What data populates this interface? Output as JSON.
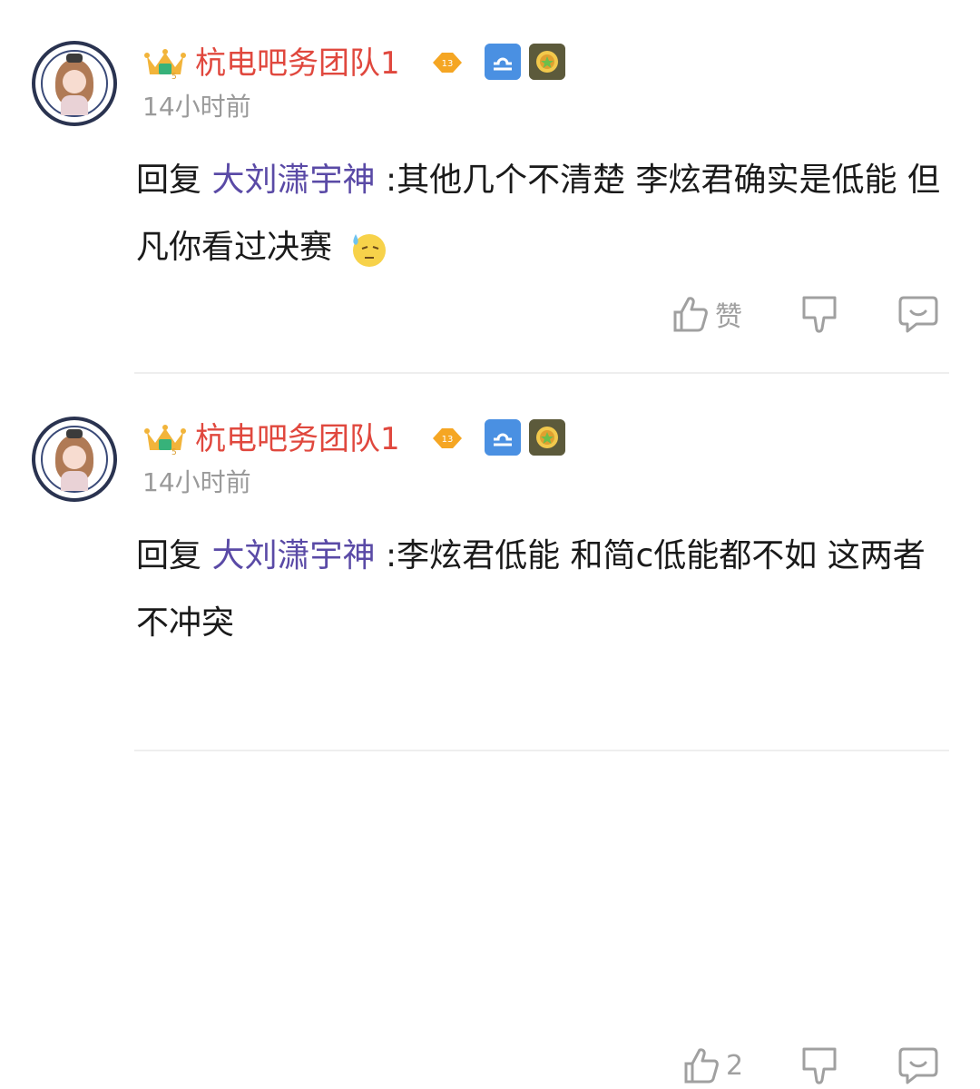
{
  "comments": [
    {
      "author": "杭电吧务团队1",
      "level": "13",
      "time": "14小时前",
      "reply_prefix": "回复",
      "reply_target": "大刘潇宇神",
      "text": " :其他几个不清楚 李炫君确实是低能 但凡你看过决赛",
      "emoji": "sweat-emoji",
      "likes": "赞"
    },
    {
      "author": "杭电吧务团队1",
      "level": "13",
      "time": "14小时前",
      "reply_prefix": "回复",
      "reply_target": "大刘潇宇神",
      "text": " :李炫君低能 和简c低能都不如 这两者不冲突",
      "likes": "2"
    }
  ],
  "colors": {
    "username": "#e0483e",
    "reply_target": "#5a4aa6",
    "time": "#9a9a9a",
    "icon": "#a0a0a0"
  }
}
